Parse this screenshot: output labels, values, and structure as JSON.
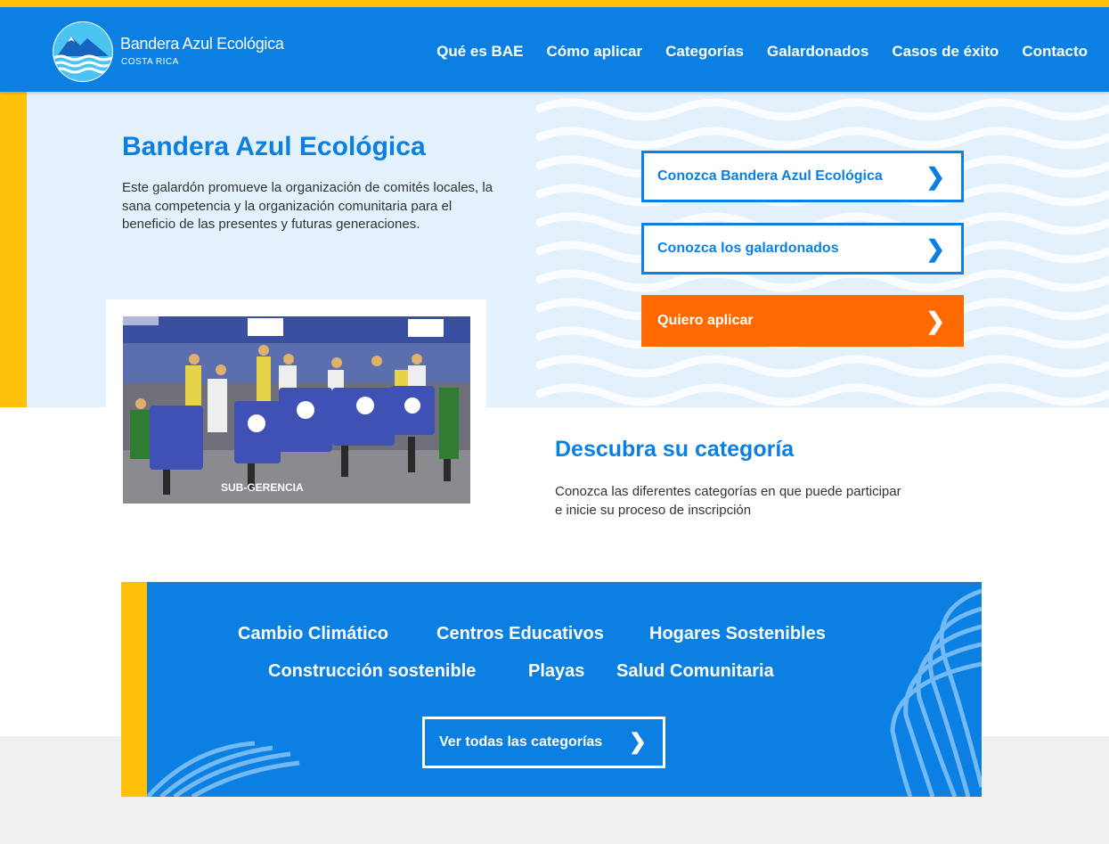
{
  "brand": {
    "name": "Bandera Azul Ecológica",
    "subtitle": "COSTA RICA"
  },
  "nav": {
    "items": [
      {
        "label": "Qué es BAE"
      },
      {
        "label": "Cómo aplicar"
      },
      {
        "label": "Categorías"
      },
      {
        "label": "Galardonados"
      },
      {
        "label": "Casos de éxito"
      },
      {
        "label": "Contacto"
      }
    ]
  },
  "hero": {
    "title": "Bandera Azul Ecológica",
    "text": "Este galardón promueve la organización de comités locales, la sana competencia y la organización comunitaria para el beneficio de las presentes y futuras generaciones.",
    "buttons": [
      {
        "label": "Conozca Bandera Azul Ecológica"
      },
      {
        "label": "Conozca los galardonados"
      },
      {
        "label": "Quiero aplicar"
      }
    ],
    "photo_banner": "SUB-GERENCIA"
  },
  "categories": {
    "title": "Descubra su categoría",
    "text": "Conozca las diferentes categorías en que puede participar e inicie su proceso de inscripción",
    "items": [
      {
        "label": "Cambio Climático"
      },
      {
        "label": "Centros Educativos"
      },
      {
        "label": "Hogares Sostenibles"
      },
      {
        "label": "Construcción sostenible"
      },
      {
        "label": "Playas"
      },
      {
        "label": "Salud Comunitaria"
      }
    ],
    "all_label": "Ver todas las categorías"
  },
  "icons": {
    "chevron": "chevron-right-icon",
    "logo": "wave-mountain-logo-icon"
  },
  "colors": {
    "primary": "#0b80e2",
    "accent": "#ffc107",
    "cta": "#ff6a00",
    "light": "#e3f1fd"
  }
}
